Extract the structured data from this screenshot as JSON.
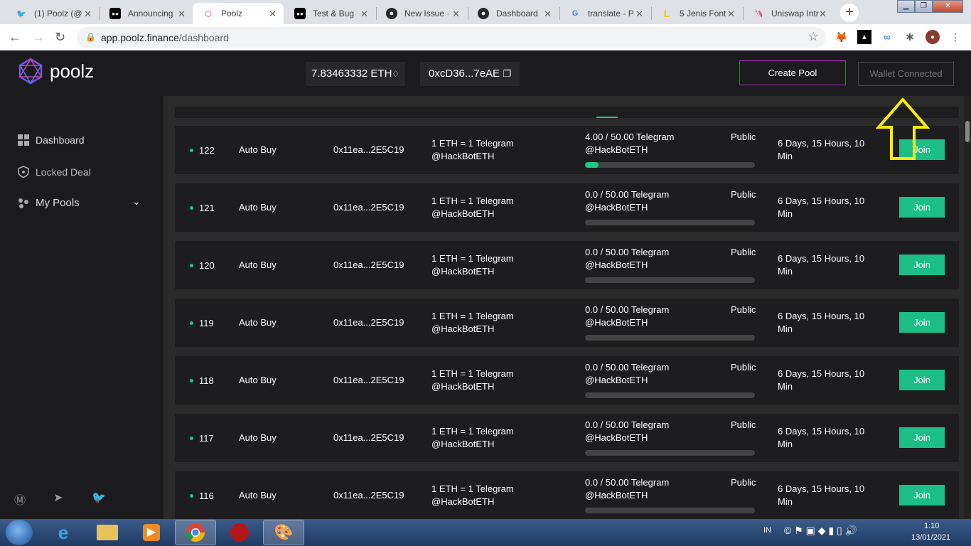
{
  "browser": {
    "tabs": [
      {
        "title": "(1) Poolz (@",
        "icon": "twitter-icon"
      },
      {
        "title": "Announcing",
        "icon": "medium-icon"
      },
      {
        "title": "Poolz",
        "icon": "poolz-icon"
      },
      {
        "title": "Test & Bug",
        "icon": "medium-icon"
      },
      {
        "title": "New Issue ·",
        "icon": "github-icon"
      },
      {
        "title": "Dashboard",
        "icon": "github-icon"
      },
      {
        "title": "translate - P",
        "icon": "google-icon"
      },
      {
        "title": "5 Jenis Font",
        "icon": "font-site-icon"
      },
      {
        "title": "Uniswap Intr",
        "icon": "uniswap-icon"
      }
    ],
    "url_host": "app.poolz.finance",
    "url_path": "/dashboard"
  },
  "header": {
    "logo_text": "poolz",
    "eth_balance": "7.83463332 ETH",
    "eth_symbol": "♢",
    "wallet_address": "0xcD36...7eAE",
    "create_pool_label": "Create Pool",
    "wallet_connected_label": "Wallet Connected"
  },
  "sidebar": {
    "dashboard": "Dashboard",
    "locked_deal": "Locked Deal",
    "my_pools": "My Pools"
  },
  "pools": [
    {
      "id": "122",
      "type": "Auto Buy",
      "address": "0x11ea...2E5C19",
      "rate_line1": "1 ETH = 1 Telegram",
      "rate_line2": "@HackBotETH",
      "amount_line1": "4.00 / 50.00 Telegram",
      "amount_line2": "@HackBotETH",
      "visibility": "Public",
      "time_line1": "6 Days, 15 Hours, 10",
      "time_line2": "Min",
      "join": "Join",
      "progress": 0.08
    },
    {
      "id": "121",
      "type": "Auto Buy",
      "address": "0x11ea...2E5C19",
      "rate_line1": "1 ETH = 1 Telegram",
      "rate_line2": "@HackBotETH",
      "amount_line1": "0.0 / 50.00 Telegram",
      "amount_line2": "@HackBotETH",
      "visibility": "Public",
      "time_line1": "6 Days, 15 Hours, 10",
      "time_line2": "Min",
      "join": "Join",
      "progress": 0
    },
    {
      "id": "120",
      "type": "Auto Buy",
      "address": "0x11ea...2E5C19",
      "rate_line1": "1 ETH = 1 Telegram",
      "rate_line2": "@HackBotETH",
      "amount_line1": "0.0 / 50.00 Telegram",
      "amount_line2": "@HackBotETH",
      "visibility": "Public",
      "time_line1": "6 Days, 15 Hours, 10",
      "time_line2": "Min",
      "join": "Join",
      "progress": 0
    },
    {
      "id": "119",
      "type": "Auto Buy",
      "address": "0x11ea...2E5C19",
      "rate_line1": "1 ETH = 1 Telegram",
      "rate_line2": "@HackBotETH",
      "amount_line1": "0.0 / 50.00 Telegram",
      "amount_line2": "@HackBotETH",
      "visibility": "Public",
      "time_line1": "6 Days, 15 Hours, 10",
      "time_line2": "Min",
      "join": "Join",
      "progress": 0
    },
    {
      "id": "118",
      "type": "Auto Buy",
      "address": "0x11ea...2E5C19",
      "rate_line1": "1 ETH = 1 Telegram",
      "rate_line2": "@HackBotETH",
      "amount_line1": "0.0 / 50.00 Telegram",
      "amount_line2": "@HackBotETH",
      "visibility": "Public",
      "time_line1": "6 Days, 15 Hours, 10",
      "time_line2": "Min",
      "join": "Join",
      "progress": 0
    },
    {
      "id": "117",
      "type": "Auto Buy",
      "address": "0x11ea...2E5C19",
      "rate_line1": "1 ETH = 1 Telegram",
      "rate_line2": "@HackBotETH",
      "amount_line1": "0.0 / 50.00 Telegram",
      "amount_line2": "@HackBotETH",
      "visibility": "Public",
      "time_line1": "6 Days, 15 Hours, 10",
      "time_line2": "Min",
      "join": "Join",
      "progress": 0
    },
    {
      "id": "116",
      "type": "Auto Buy",
      "address": "0x11ea...2E5C19",
      "rate_line1": "1 ETH = 1 Telegram",
      "rate_line2": "@HackBotETH",
      "amount_line1": "0.0 / 50.00 Telegram",
      "amount_line2": "@HackBotETH",
      "visibility": "Public",
      "time_line1": "6 Days, 15 Hours, 10",
      "time_line2": "Min",
      "join": "Join",
      "progress": 0
    }
  ],
  "taskbar": {
    "language": "IN",
    "time": "1:10",
    "date": "13/01/2021"
  },
  "colors": {
    "accent_green": "#1ec886",
    "create_pool_border": "#b627c9",
    "annotation_arrow": "#ffee00"
  }
}
